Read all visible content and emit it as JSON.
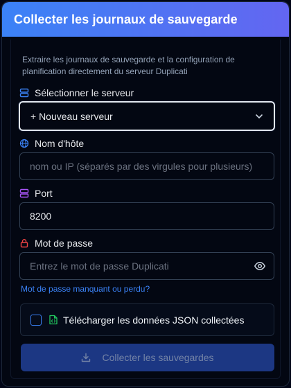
{
  "dialog": {
    "title": "Collecter les journaux de sauvegarde",
    "description": "Extraire les journaux de sauvegarde et la configuration de planification directement du serveur Duplicati"
  },
  "server": {
    "label": "Sélectionner le serveur",
    "selected": "+ Nouveau serveur"
  },
  "hostname": {
    "label": "Nom d'hôte",
    "placeholder": "nom ou IP (séparés par des virgules pour plusieurs)"
  },
  "port": {
    "label": "Port",
    "value": "8200"
  },
  "password": {
    "label": "Mot de passe",
    "placeholder": "Entrez le mot de passe Duplicati",
    "forgot_link": "Mot de passe manquant ou perdu?"
  },
  "download_json": {
    "label": "Télécharger les données JSON collectées",
    "checked": false
  },
  "collect_button": {
    "label": "Collecter les sauvegardes"
  },
  "colors": {
    "header_start": "#3b82f6",
    "header_end": "#6366f1",
    "server_icon": "#3b82f6",
    "hostname_icon": "#3b82f6",
    "port_icon": "#a855f7",
    "password_icon": "#ef4444",
    "json_icon": "#22c55e",
    "link": "#3b82f6"
  },
  "icons": {
    "server": "server-stack-icon",
    "hostname": "globe-icon",
    "port": "port-server-icon",
    "password": "lock-icon",
    "select": "chevron-down-icon",
    "visibility": "eye-icon",
    "json": "file-json-icon",
    "download": "download-icon"
  }
}
